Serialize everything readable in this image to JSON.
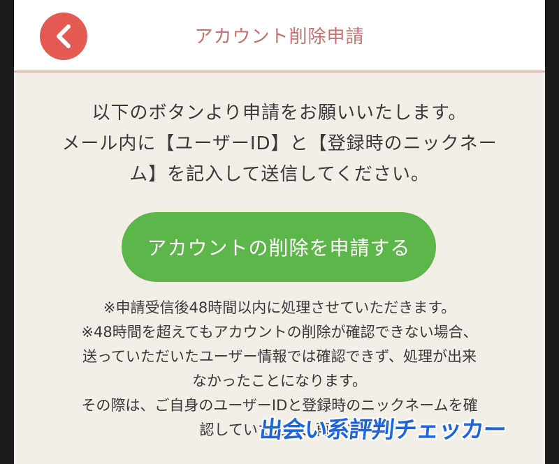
{
  "header": {
    "title": "アカウント削除申請",
    "back_icon": "chevron-left-icon"
  },
  "intro": {
    "lines": [
      "以下のボタンより申請をお願いいたします。",
      "メール内に【ユーザーID】と【登録時のニックネー",
      "ム】を記入して送信してください。"
    ]
  },
  "request_button": {
    "label": "アカウントの削除を申請する"
  },
  "notes": {
    "lines": [
      "※申請受信後48時間以内に処理させていただきます。",
      "※48時間を超えてもアカウントの削除が確認できない場合、",
      "送っていただいたユーザー情報では確認できず、処理が出来",
      "なかったことになります。",
      "その際は、ご自身のユーザーIDと登録時のニックネームを確",
      "認していただき、再度ご"
    ]
  },
  "watermark": {
    "text": "出会い系評判チェッカー"
  },
  "colors": {
    "accent": "#e35b52",
    "title": "#c96f6f",
    "button": "#5db64a",
    "background": "#f3efe6",
    "watermark": "#1e63e0"
  }
}
